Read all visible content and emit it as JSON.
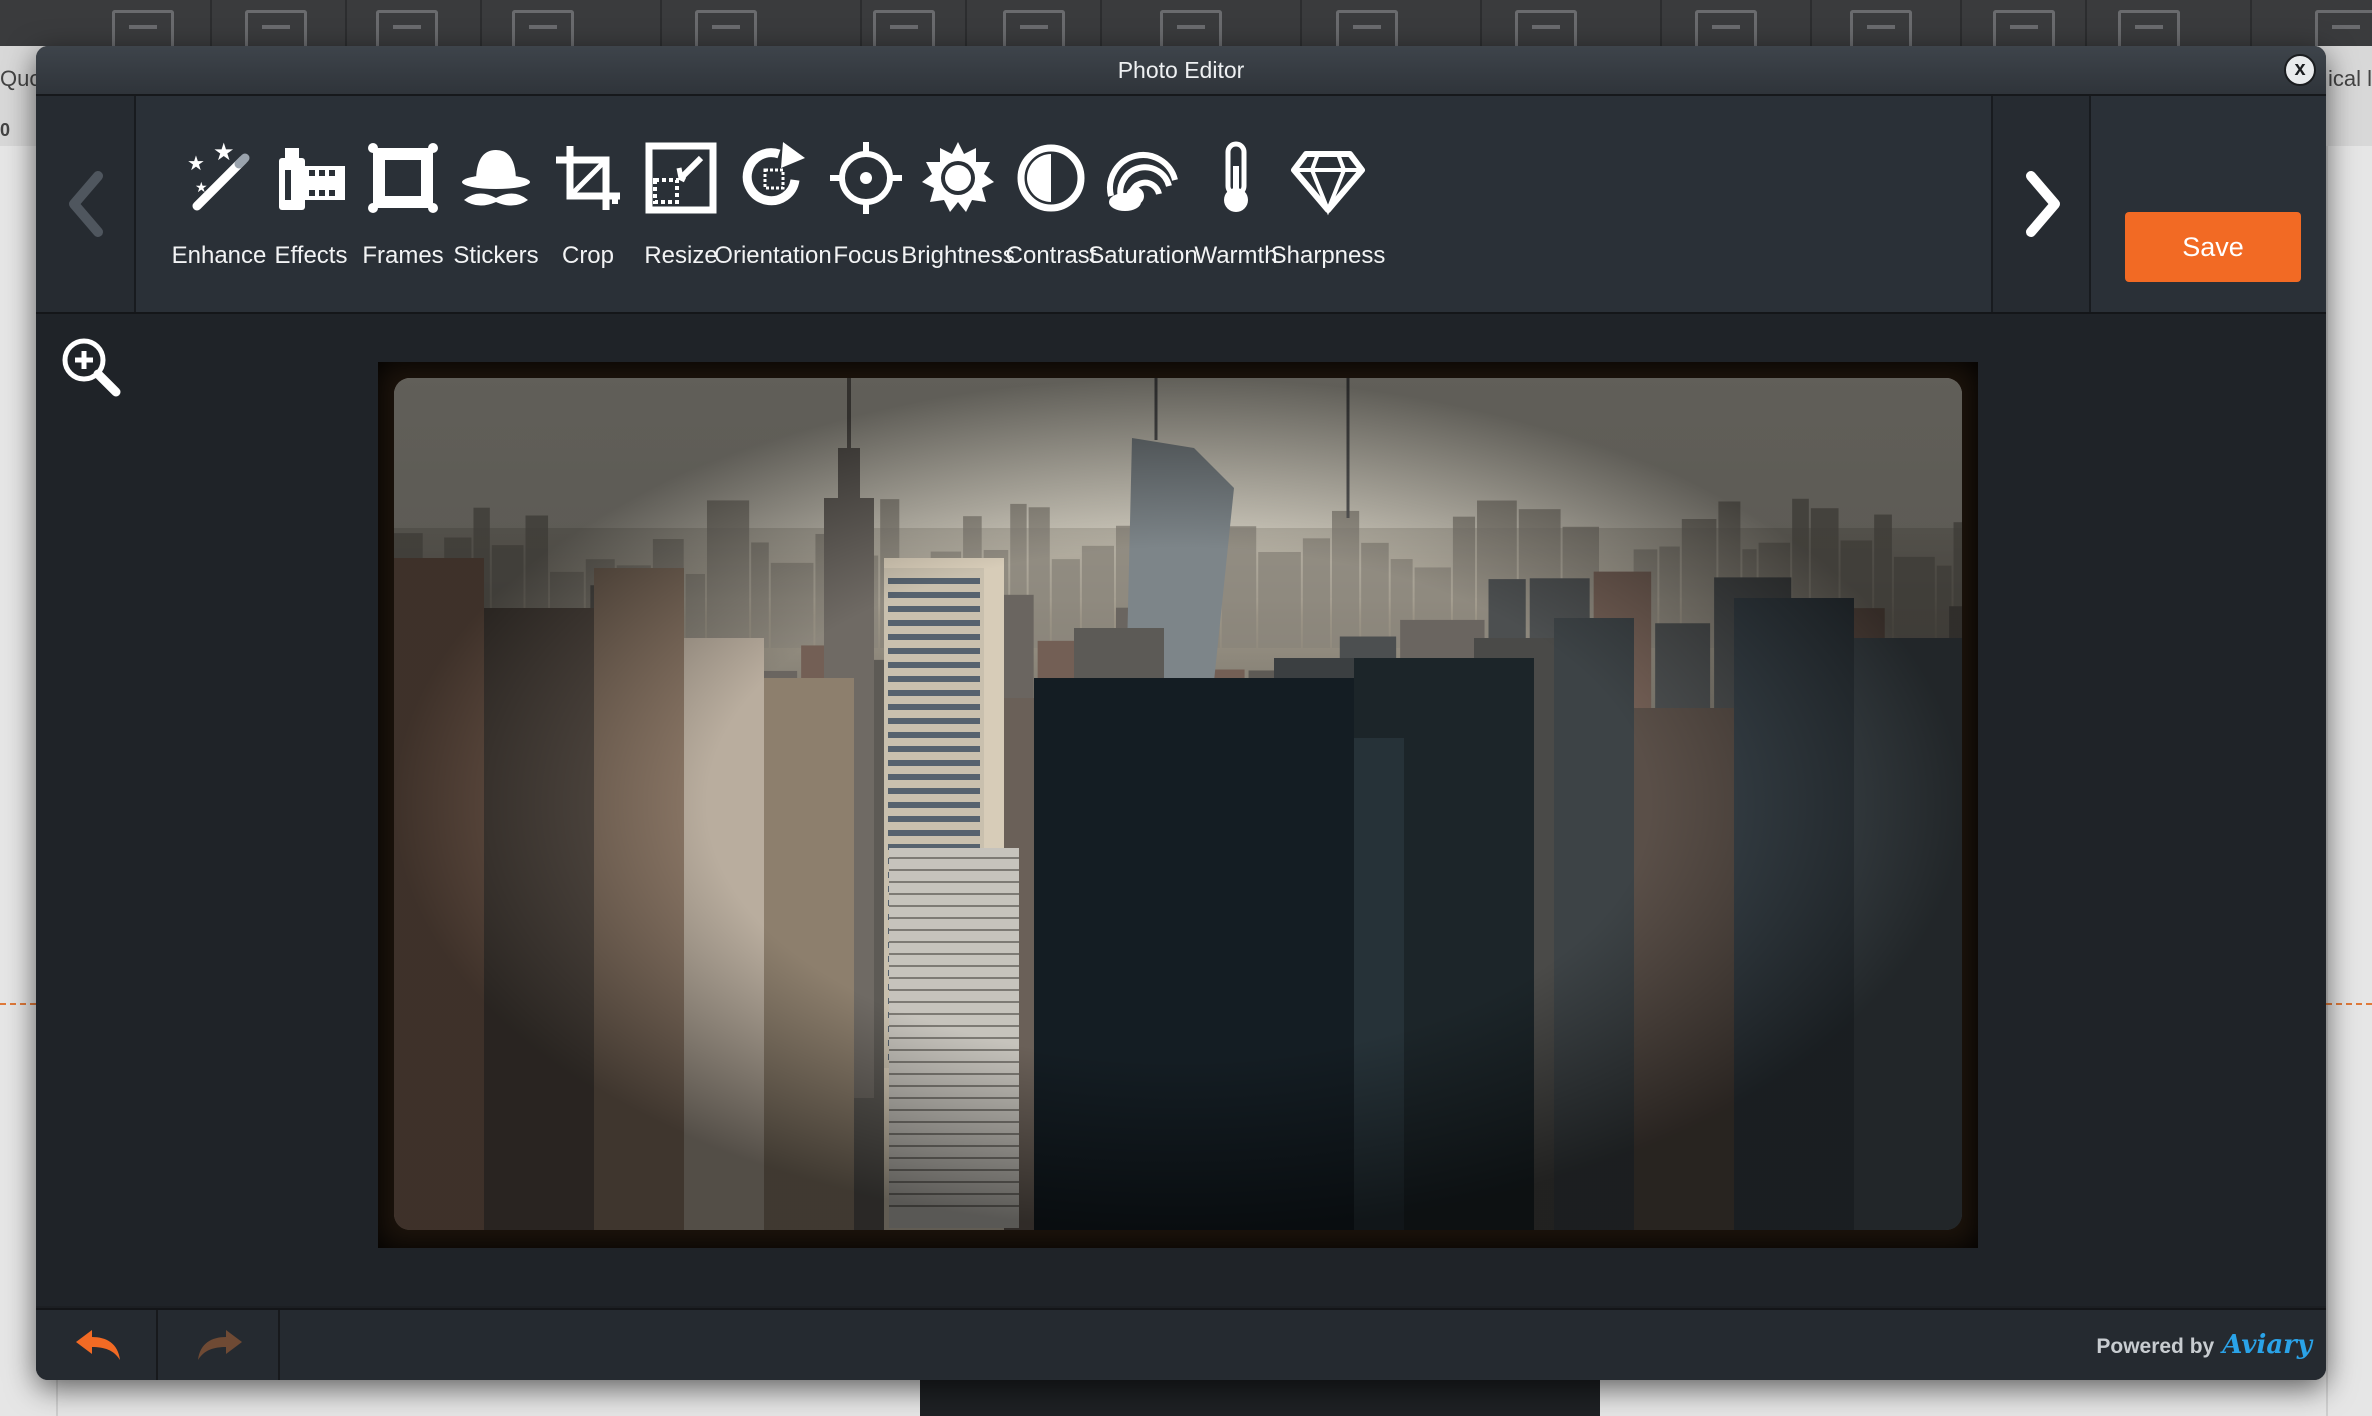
{
  "background": {
    "left_label": "Quo",
    "left_number": "0",
    "right_label": "ical l"
  },
  "editor": {
    "title": "Photo Editor",
    "close_label": "x",
    "save_label": "Save",
    "tools": [
      {
        "label": "Enhance",
        "icon": "magic-wand-icon"
      },
      {
        "label": "Effects",
        "icon": "film-roll-icon"
      },
      {
        "label": "Frames",
        "icon": "frame-icon"
      },
      {
        "label": "Stickers",
        "icon": "hat-mustache-icon"
      },
      {
        "label": "Crop",
        "icon": "crop-icon"
      },
      {
        "label": "Resize",
        "icon": "resize-icon"
      },
      {
        "label": "Orientation",
        "icon": "rotate-icon"
      },
      {
        "label": "Focus",
        "icon": "crosshair-icon"
      },
      {
        "label": "Brightness",
        "icon": "sun-icon"
      },
      {
        "label": "Contrast",
        "icon": "contrast-icon"
      },
      {
        "label": "Saturation",
        "icon": "rainbow-icon"
      },
      {
        "label": "Warmth",
        "icon": "thermometer-icon"
      },
      {
        "label": "Sharpness",
        "icon": "diamond-icon"
      }
    ],
    "footer": {
      "powered_by": "Powered by",
      "brand": "Aviary"
    },
    "colors": {
      "accent": "#f26a24",
      "brand": "#2aa3e8"
    }
  }
}
